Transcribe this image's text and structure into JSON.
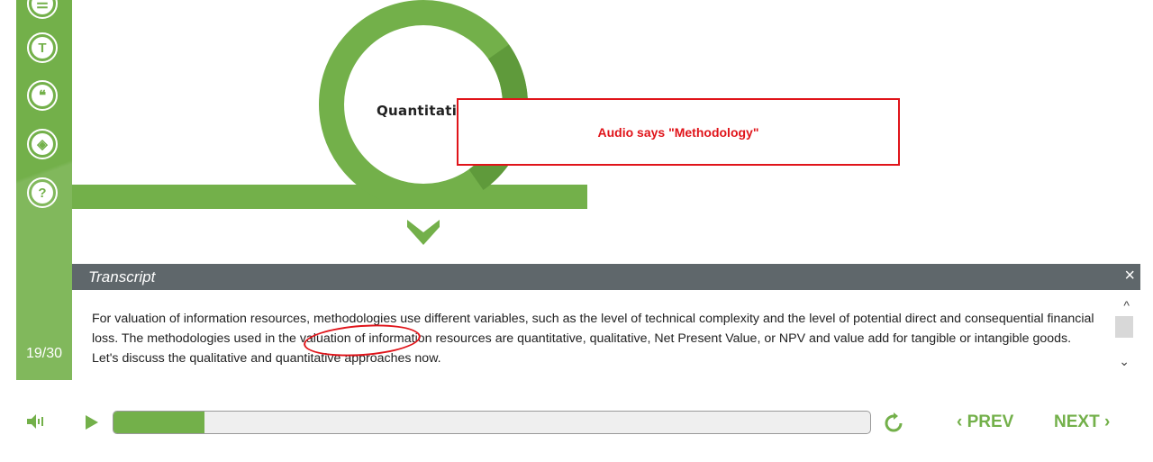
{
  "sidebar": {
    "buttons": [
      {
        "name": "menu-icon",
        "glyph": "☰"
      },
      {
        "name": "transcript-icon",
        "glyph": "T"
      },
      {
        "name": "quote-icon",
        "glyph": "❝"
      },
      {
        "name": "resources-icon",
        "glyph": "◈"
      },
      {
        "name": "help-icon",
        "glyph": "?"
      }
    ],
    "page_counter": "19/30"
  },
  "slide": {
    "ring_label": "Quantitativ"
  },
  "annotation": {
    "text": "Audio says \"Methodology\""
  },
  "transcript": {
    "title": "Transcript",
    "close_glyph": "×",
    "text": "For valuation of information resources, methodologies use different variables, such as the level of technical complexity and the level of potential direct and consequential financial loss. The methodologies used in the valuation of information resources are quantitative, qualitative, Net Present Value, or NPV and value add for tangible or intangible goods. Let's discuss the qualitative and quantitative approaches now.",
    "scroll_up_glyph": "^",
    "scroll_down_glyph": "⌄"
  },
  "controls": {
    "progress_fraction": 0.12,
    "prev_label": "‹ PREV",
    "next_label": "NEXT ›"
  },
  "colors": {
    "accent": "#73b04a",
    "annotation": "#e0141a",
    "transcript_header": "#5f676b"
  }
}
